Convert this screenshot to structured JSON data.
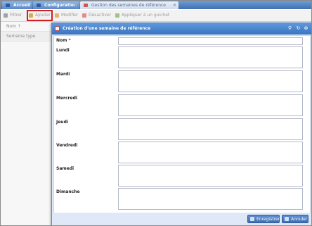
{
  "tabs": [
    {
      "label": "Accueil",
      "icon": "home-icon"
    },
    {
      "label": "Configuration",
      "icon": "config-icon"
    },
    {
      "label": "Gestion des semaines de référence",
      "icon": "calendar-icon"
    }
  ],
  "toolbar": {
    "filter": "Filtrer",
    "add": "Ajouter",
    "edit": "Modifier",
    "disable": "Désactiver",
    "apply": "Appliquer à un guichet"
  },
  "list": {
    "col_name": "Nom ↑",
    "row1": "Semaine type"
  },
  "dialog": {
    "title": "Création d'une semaine de référence",
    "name_label": "Nom",
    "required_mark": "*",
    "days": [
      "Lundi",
      "Mardi",
      "Mercredi",
      "Jeudi",
      "Vendredi",
      "Samedi",
      "Dimanche"
    ],
    "save": "Enregistrer",
    "cancel": "Annuler"
  },
  "colors": {
    "header": "#3a74be",
    "highlight": "#d21f1f",
    "required": "#d01010"
  }
}
